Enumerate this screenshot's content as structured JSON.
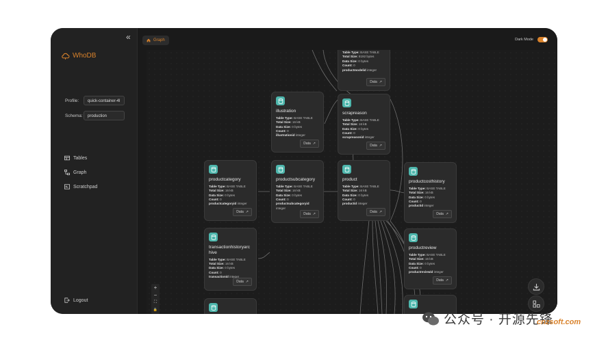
{
  "app": {
    "name": "WhoDB",
    "accent": "#d9822b",
    "node_icon_color": "#4db6ac"
  },
  "sidebar": {
    "profile_label": "Profile:",
    "profile_value": "quick-container-4l",
    "schema_label": "Schema:",
    "schema_value": "production",
    "nav": [
      {
        "label": "Tables",
        "icon": "table-icon"
      },
      {
        "label": "Graph",
        "icon": "graph-icon"
      },
      {
        "label": "Scratchpad",
        "icon": "scratchpad-icon"
      }
    ],
    "logout_label": "Logout"
  },
  "header": {
    "tab_label": "Graph",
    "dark_mode_label": "Dark Mode",
    "dark_mode_on": true
  },
  "nodes": {
    "productmodel": {
      "title": "",
      "type": "BASE TABLE",
      "size": "8192 bytes",
      "data_size": "0 bytes",
      "count": "0",
      "key_name": "productmodelid",
      "key_type": "integer"
    },
    "illustration": {
      "title": "illustration",
      "type": "BASE TABLE",
      "size": "16 kB",
      "data_size": "0 bytes",
      "count": "0",
      "key_name": "illustrationid",
      "key_type": "integer"
    },
    "scrapreason": {
      "title": "scrapreason",
      "type": "BASE TABLE",
      "size": "16 kB",
      "data_size": "0 bytes",
      "count": "0",
      "key_name": "scrapreasonid",
      "key_type": "integer"
    },
    "productcategory": {
      "title": "productcategory",
      "type": "BASE TABLE",
      "size": "16 kB",
      "data_size": "0 bytes",
      "count": "0",
      "key_name": "productcategoryid",
      "key_type": "integer"
    },
    "productsubcategory": {
      "title": "productsubcategory",
      "type": "BASE TABLE",
      "size": "16 kB",
      "data_size": "0 bytes",
      "count": "0",
      "key_name": "productsubcategoryid",
      "key_type": "integer"
    },
    "product": {
      "title": "product",
      "type": "BASE TABLE",
      "size": "16 kB",
      "data_size": "0 bytes",
      "count": "0",
      "key_name": "productid",
      "key_type": "integer"
    },
    "productcosthistory": {
      "title": "productcosthistory",
      "type": "BASE TABLE",
      "size": "16 kB",
      "data_size": "0 bytes",
      "count": "0",
      "key_name": "productid",
      "key_type": "integer"
    },
    "transactionhistoryarchive": {
      "title": "transactionhistoryarchive",
      "type": "BASE TABLE",
      "size": "16 kB",
      "data_size": "0 bytes",
      "count": "0",
      "key_name": "transactionid",
      "key_type": "integer"
    },
    "productreview": {
      "title": "productreview",
      "type": "BASE TABLE",
      "size": "16 kB",
      "data_size": "0 bytes",
      "count": "0",
      "key_name": "productreviewid",
      "key_type": "integer"
    }
  },
  "node_labels": {
    "type": "Table Type:",
    "size": "Total Size:",
    "data_size": "Data Size:",
    "count": "Count:",
    "data_button": "Data"
  },
  "controls": {
    "zoom_in": "+",
    "zoom_out": "−",
    "fit": "⛶",
    "lock": "🔒"
  },
  "watermark": {
    "text": "公众号 · 开源先锋",
    "url": "cnzsoft.com"
  }
}
